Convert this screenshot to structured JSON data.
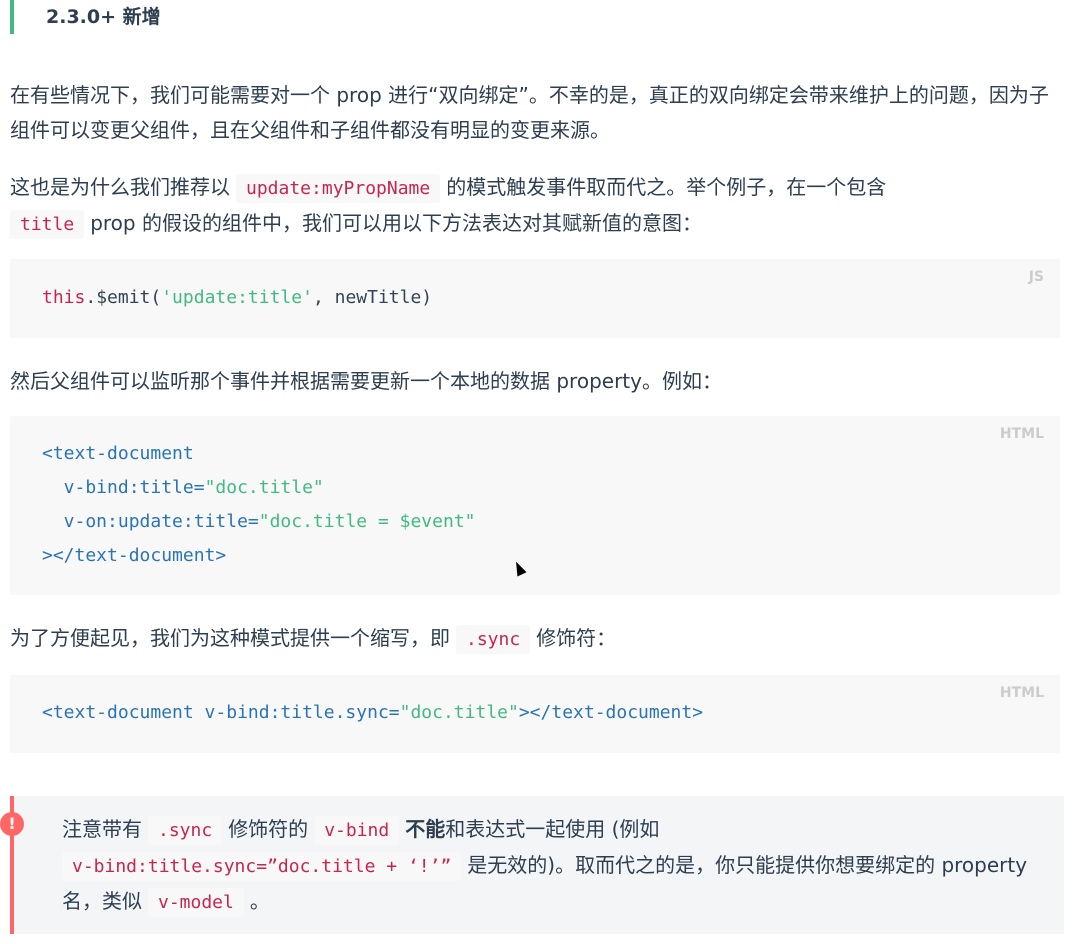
{
  "section_tag": "2.3.0+ 新增",
  "p1": "在有些情况下，我们可能需要对一个 prop 进行“双向绑定”。不幸的是，真正的双向绑定会带来维护上的问题，因为子组件可以变更父组件，且在父组件和子组件都没有明显的变更来源。",
  "p2": {
    "a": "这也是为什么我们推荐以",
    "code1": "update:myPropName",
    "b": "的模式触发事件取而代之。举个例子，在一个包含",
    "code2": "title",
    "c": "prop 的假设的组件中，我们可以用以下方法表达对其赋新值的意图："
  },
  "code_js": {
    "lang": "JS",
    "kw": "this",
    "rest1": ".$emit(",
    "str": "'update:title'",
    "rest2": ", newTitle)"
  },
  "p3": "然后父组件可以监听那个事件并根据需要更新一个本地的数据 property。例如：",
  "code_html1": {
    "lang": "HTML",
    "l1_tag": "<text-document",
    "l2_attr": "  v-bind:title=",
    "l2_str": "\"doc.title\"",
    "l3_attr": "  v-on:update:title=",
    "l3_str": "\"doc.title = $event\"",
    "l4_tag": "></text-document>"
  },
  "p4": {
    "a": "为了方便起见，我们为这种模式提供一个缩写，即",
    "code": ".sync",
    "b": "修饰符："
  },
  "code_html2": {
    "lang": "HTML",
    "tag1": "<text-document v-bind:title.sync=",
    "str": "\"doc.title\"",
    "tag2": "></text-document>"
  },
  "warning": {
    "icon": "!",
    "a": "注意带有",
    "code1": ".sync",
    "b": "修饰符的",
    "code2": "v-bind",
    "strong": "不能",
    "c": "和表达式一起使用 (例如",
    "code3": "v-bind:title.sync=”doc.title + ‘!’”",
    "d": "是无效的)。取而代之的是，你只能提供你想要绑定的 property 名，类似",
    "code4": "v-model",
    "e": "。"
  },
  "colors": {
    "accent": "#42b983",
    "code_red": "#c7254e",
    "warning": "#ff6666",
    "tag_blue": "#2973b7"
  }
}
